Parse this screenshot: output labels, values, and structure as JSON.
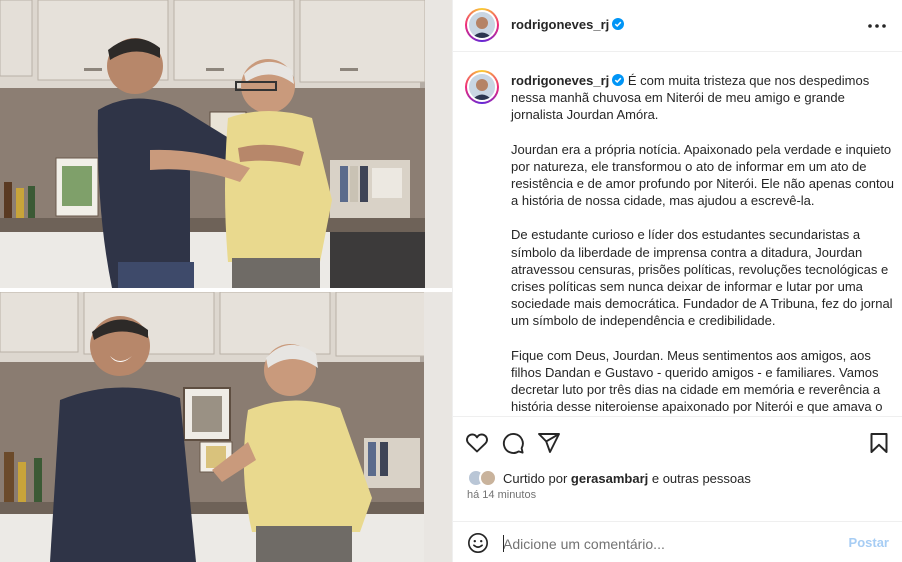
{
  "post": {
    "username": "rodrigoneves_rj",
    "verified": true,
    "more_icon": "more-horizontal-icon"
  },
  "caption": {
    "paragraphs": [
      "É com muita tristeza que nos despedimos nessa manhã chuvosa em Niterói de meu amigo e grande jornalista Jourdan Amóra.",
      "Jourdan era a própria notícia. Apaixonado pela verdade e inquieto por natureza, ele transformou o ato de informar em um ato de resistência e de amor profundo por Niterói. Ele não apenas contou a história de nossa cidade, mas ajudou a escrevê-la.",
      "De estudante curioso e líder dos estudantes secundaristas a símbolo da liberdade de imprensa contra a ditadura, Jourdan atravessou censuras, prisões políticas, revoluções tecnológicas e crises políticas sem nunca deixar de informar e lutar por uma sociedade mais democrática. Fundador de A Tribuna, fez do jornal um símbolo de independência e credibilidade.",
      "Fique com Deus, Jourdan. Meus sentimentos aos amigos, aos filhos Dandan e Gustavo - querido amigos - e familiares. Vamos decretar luto por três dias na cidade em memória e reverência a história desse niteroiense apaixonado por Niterói e que amava o jornalismo e a democracia."
    ]
  },
  "actions": {
    "like_icon": "heart-icon",
    "comment_icon": "comment-icon",
    "share_icon": "share-icon",
    "save_icon": "bookmark-icon"
  },
  "likes": {
    "prefix": "Curtido por ",
    "user": "gerasambarj",
    "suffix": " e outras pessoas"
  },
  "time": "há 14 minutos",
  "comment": {
    "placeholder": "Adicione um comentário...",
    "post_label": "Postar"
  },
  "colors": {
    "accent_blue": "#0095f6",
    "post_disabled": "#a7cdf4",
    "border": "#efefef"
  }
}
